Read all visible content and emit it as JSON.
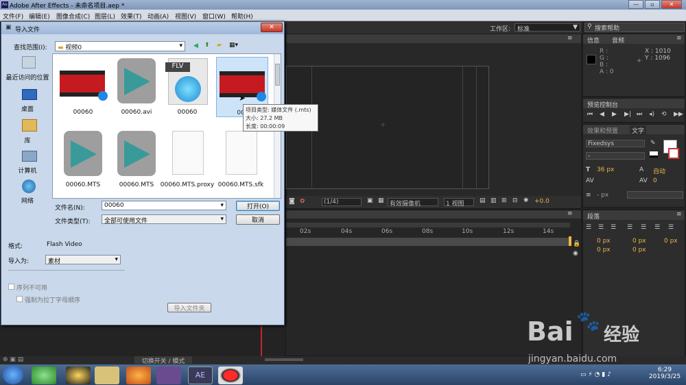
{
  "window": {
    "title": "Adobe After Effects - 未命名项目.aep *",
    "btn_min": "—",
    "btn_max": "▫",
    "btn_close": "✕"
  },
  "menu": [
    "文件(F)",
    "编辑(E)",
    "图像合成(C)",
    "图层(L)",
    "效果(T)",
    "动画(A)",
    "视图(V)",
    "窗口(W)",
    "帮助(H)"
  ],
  "workspace": {
    "label": "工作区:",
    "value": "标准",
    "search_placeholder": "搜索帮助"
  },
  "info_panel": {
    "tabs": [
      "信息",
      "音频"
    ],
    "r": "R :",
    "g": "G :",
    "b": "B :",
    "a": "A : 0",
    "x": "X : 1010",
    "y": "Y : 1096"
  },
  "preview_panel": {
    "tab": "预览控制台"
  },
  "effects_panel": {
    "tabs": [
      "效果和预置",
      "文字"
    ]
  },
  "char_panel": {
    "font": "Fixedsys",
    "style": "-",
    "size": "36 px",
    "leading": "自动",
    "tracking": "0",
    "kerning": "",
    "indent": "- px"
  },
  "para_panel": {
    "tab": "段落",
    "v1": "0 px",
    "v2": "0 px",
    "v3": "0 px",
    "v4": "0 px",
    "v5": "0 px"
  },
  "comp_toolbar": {
    "res": "(1/4)",
    "camera": "有效摄像机",
    "views": "1 视图",
    "offset": "+0.0"
  },
  "timeline": {
    "ticks": [
      "02s",
      "04s",
      "06s",
      "08s",
      "10s",
      "12s",
      "14s"
    ],
    "toggle_label": "切换开关 / 模式"
  },
  "dialog": {
    "title": "导入文件",
    "look_in_label": "查找范围(I):",
    "look_in_value": "视频0",
    "places": [
      "最近访问的位置",
      "桌面",
      "库",
      "计算机",
      "网络"
    ],
    "files": [
      {
        "name": "00060",
        "kind": "video-thumb"
      },
      {
        "name": "00060.avi",
        "kind": "mts-icon"
      },
      {
        "name": "00060",
        "kind": "flv-icon"
      },
      {
        "name": "000",
        "kind": "video-thumb"
      },
      {
        "name": "00060.MTS",
        "kind": "mts-icon"
      },
      {
        "name": "00060.MTS",
        "kind": "mts-icon"
      },
      {
        "name": "00060.MTS.proxy",
        "kind": "blank"
      },
      {
        "name": "00060.MTS.sfk",
        "kind": "blank"
      }
    ],
    "tooltip": {
      "line1": "项目类型: 媒体文件 (.mts)",
      "line2": "大小: 27.2 MB",
      "line3": "长度: 00:00:09"
    },
    "filename_label": "文件名(N):",
    "filename_value": "00060",
    "filetype_label": "文件类型(T):",
    "filetype_value": "全部可使用文件",
    "open_button": "打开(O)",
    "cancel_button": "取消",
    "format_label": "格式:",
    "format_value": "Flash Video",
    "import_as_label": "导入为:",
    "import_as_value": "素材",
    "sequence_label": "序列不可用",
    "force_label": "强制为拉丁字母顺序",
    "import_folder_button": "导入文件夹"
  },
  "taskbar": {
    "clock_time": "6:29",
    "clock_date": "2019/3/25"
  },
  "watermark": {
    "brand": "Bai",
    "brand2": "经验",
    "url": "jingyan.baidu.com"
  }
}
